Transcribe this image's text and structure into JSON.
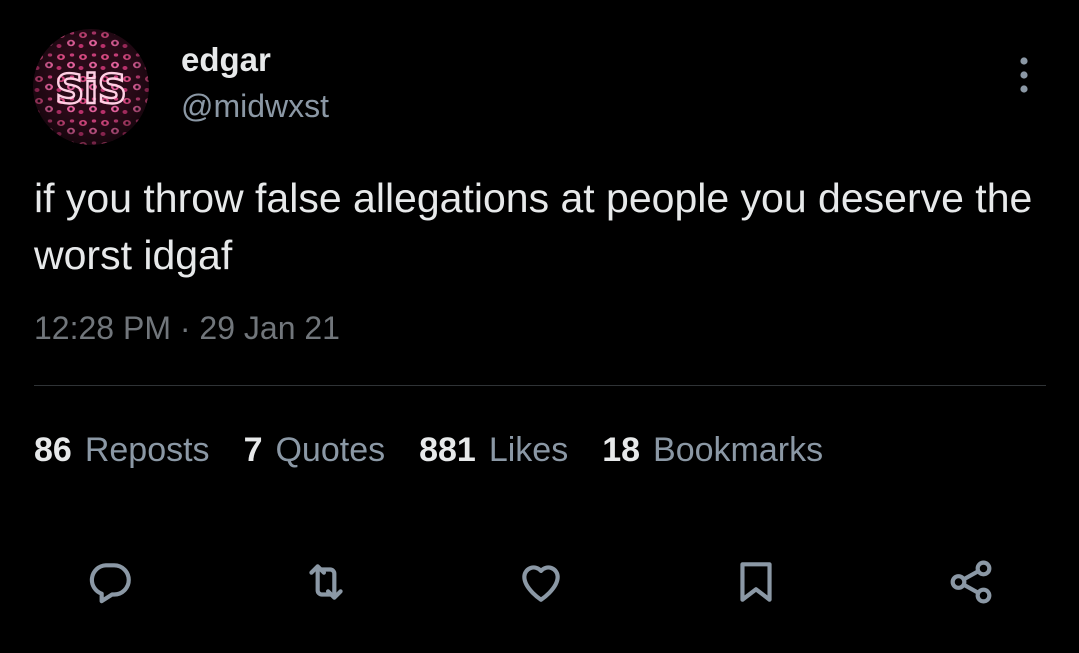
{
  "colors": {
    "background": "#000000",
    "primary_text": "#e7e9ea",
    "secondary_text": "#8b98a5",
    "timestamp_text": "#71767b",
    "icon": "#8b98a5",
    "divider": "#2f3336",
    "avatar_accent": "#ff2d87"
  },
  "author": {
    "display_name": "edgar",
    "handle": "@midwxst",
    "avatar_text": "SiS"
  },
  "tweet": {
    "text": "if you throw false allegations at people you deserve the worst idgaf",
    "timestamp": "12:28 PM · 29 Jan 21"
  },
  "stats": [
    {
      "count": "86",
      "label": "Reposts"
    },
    {
      "count": "7",
      "label": "Quotes"
    },
    {
      "count": "881",
      "label": "Likes"
    },
    {
      "count": "18",
      "label": "Bookmarks"
    }
  ],
  "actions": {
    "reply_icon": "reply-icon",
    "repost_icon": "repost-icon",
    "like_icon": "heart-icon",
    "bookmark_icon": "bookmark-icon",
    "share_icon": "share-icon",
    "more_icon": "more-vertical-icon"
  }
}
